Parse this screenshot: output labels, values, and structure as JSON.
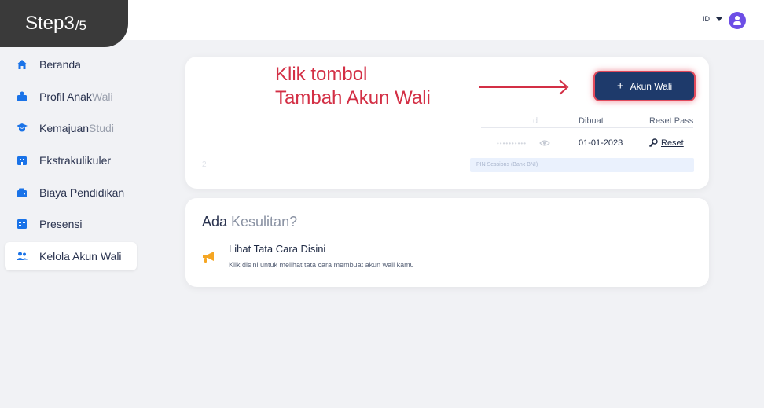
{
  "step": {
    "current": "3",
    "total": "/5",
    "label": "Step "
  },
  "header": {
    "language": "ID"
  },
  "sidebar": {
    "items": [
      {
        "label": "Beranda",
        "faded": "",
        "icon": "home-icon"
      },
      {
        "label": "Profil Anak ",
        "faded": "Wali",
        "icon": "profile-icon"
      },
      {
        "label": "Kemajuan ",
        "faded": "Studi",
        "icon": "graduation-icon"
      },
      {
        "label": "Ekstrakulikuler",
        "faded": "",
        "icon": "building-icon"
      },
      {
        "label": "Biaya Pendidikan",
        "faded": "",
        "icon": "wallet-icon"
      },
      {
        "label": "Presensi",
        "faded": "",
        "icon": "attendance-icon"
      },
      {
        "label": "Kelola Akun Wali",
        "faded": "",
        "icon": "users-icon",
        "active": true
      }
    ]
  },
  "annotation": {
    "line1": "Klik tombol",
    "line2": "Tambah Akun Wali"
  },
  "accounts": {
    "add_button": "Akun Wali",
    "headers": {
      "faint": "d",
      "created": "Dibuat",
      "reset": "Reset Pass"
    },
    "row1": {
      "password": "••••••••••",
      "created": "01-01-2023",
      "reset": "Reset"
    },
    "row2": {
      "num": "2",
      "info": "PIN Sessions (Bank BNI)"
    }
  },
  "help": {
    "title_main": "Ada ",
    "title_faded": "Kesulitan?",
    "item_title": "Lihat Tata Cara Disini",
    "item_desc": "Klik disini untuk melihat tata cara membuat akun wali kamu"
  },
  "colors": {
    "accent": "#1e3a6b",
    "annotation": "#d32f45",
    "avatar": "#6d4ee6",
    "nav_icon": "#1a73e8"
  }
}
